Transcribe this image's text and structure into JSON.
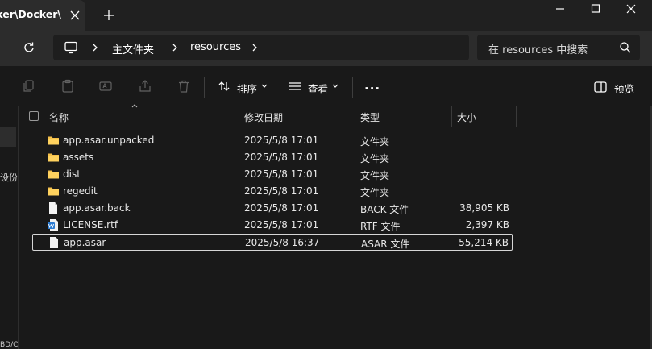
{
  "window": {
    "tab_title": "\\Docker\\Docker",
    "minimize_label": "—",
    "maximize_label": "□",
    "close_label": "✕"
  },
  "address": {
    "crumbs": [
      "主文件夹",
      "resources"
    ],
    "search_placeholder": "在 resources 中搜索"
  },
  "toolbar": {
    "sort_label": "排序",
    "view_label": "查看",
    "more_label": "...",
    "preview_label": "预览"
  },
  "nav": {
    "partial_label": "设份存",
    "partial_bottom": "BD/C"
  },
  "columns": {
    "name": "名称",
    "date": "修改日期",
    "type": "类型",
    "size": "大小"
  },
  "files": [
    {
      "name": "app.asar.unpacked",
      "date": "2025/5/8 17:01",
      "type": "文件夹",
      "size": "",
      "icon": "folder-icon"
    },
    {
      "name": "assets",
      "date": "2025/5/8 17:01",
      "type": "文件夹",
      "size": "",
      "icon": "folder-icon"
    },
    {
      "name": "dist",
      "date": "2025/5/8 17:01",
      "type": "文件夹",
      "size": "",
      "icon": "folder-icon"
    },
    {
      "name": "regedit",
      "date": "2025/5/8 17:01",
      "type": "文件夹",
      "size": "",
      "icon": "folder-icon"
    },
    {
      "name": "app.asar.back",
      "date": "2025/5/8 17:01",
      "type": "BACK 文件",
      "size": "38,905 KB",
      "icon": "file-icon"
    },
    {
      "name": "LICENSE.rtf",
      "date": "2025/5/8 17:01",
      "type": "RTF 文件",
      "size": "2,397 KB",
      "icon": "word-doc-icon"
    },
    {
      "name": "app.asar",
      "date": "2025/5/8 16:37",
      "type": "ASAR 文件",
      "size": "55,214 KB",
      "icon": "file-icon"
    }
  ],
  "colors": {
    "background": "#191919",
    "titlebar": "#202020",
    "tab": "#2c2c2c",
    "folder": "#f5c04a",
    "accent": "#6cb8f0"
  }
}
